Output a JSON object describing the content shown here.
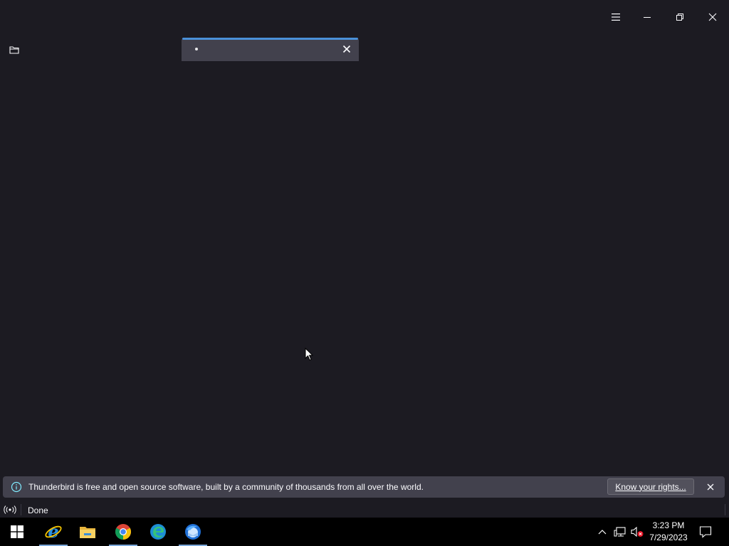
{
  "window": {
    "title": "",
    "controls": {
      "menu_icon": "hamburger-menu-icon",
      "minimize_icon": "minimize-icon",
      "restore_icon": "restore-icon",
      "close_icon": "close-icon"
    }
  },
  "tabs": [
    {
      "title": "",
      "loading": true,
      "active": true
    }
  ],
  "notification": {
    "message": "Thunderbird is free and open source software, built by a community of thousands from all over the world.",
    "button_label": "Know your rights...",
    "icon": "info-icon"
  },
  "status": {
    "text": "Done",
    "icon": "online-status-icon"
  },
  "taskbar": {
    "apps": [
      {
        "name": "Internet Explorer",
        "icon": "internet-explorer-icon",
        "active": true
      },
      {
        "name": "File Explorer",
        "icon": "file-explorer-icon",
        "active": false
      },
      {
        "name": "Google Chrome",
        "icon": "chrome-icon",
        "active": true
      },
      {
        "name": "Microsoft Edge",
        "icon": "edge-icon",
        "active": false
      },
      {
        "name": "Thunderbird",
        "icon": "thunderbird-icon",
        "active": true
      }
    ],
    "clock": {
      "time": "3:23 PM",
      "date": "7/29/2023"
    }
  },
  "colors": {
    "background": "#1c1b22",
    "tab_active": "#42414d",
    "accent": "#4a90d9",
    "taskbar": "#000000"
  }
}
